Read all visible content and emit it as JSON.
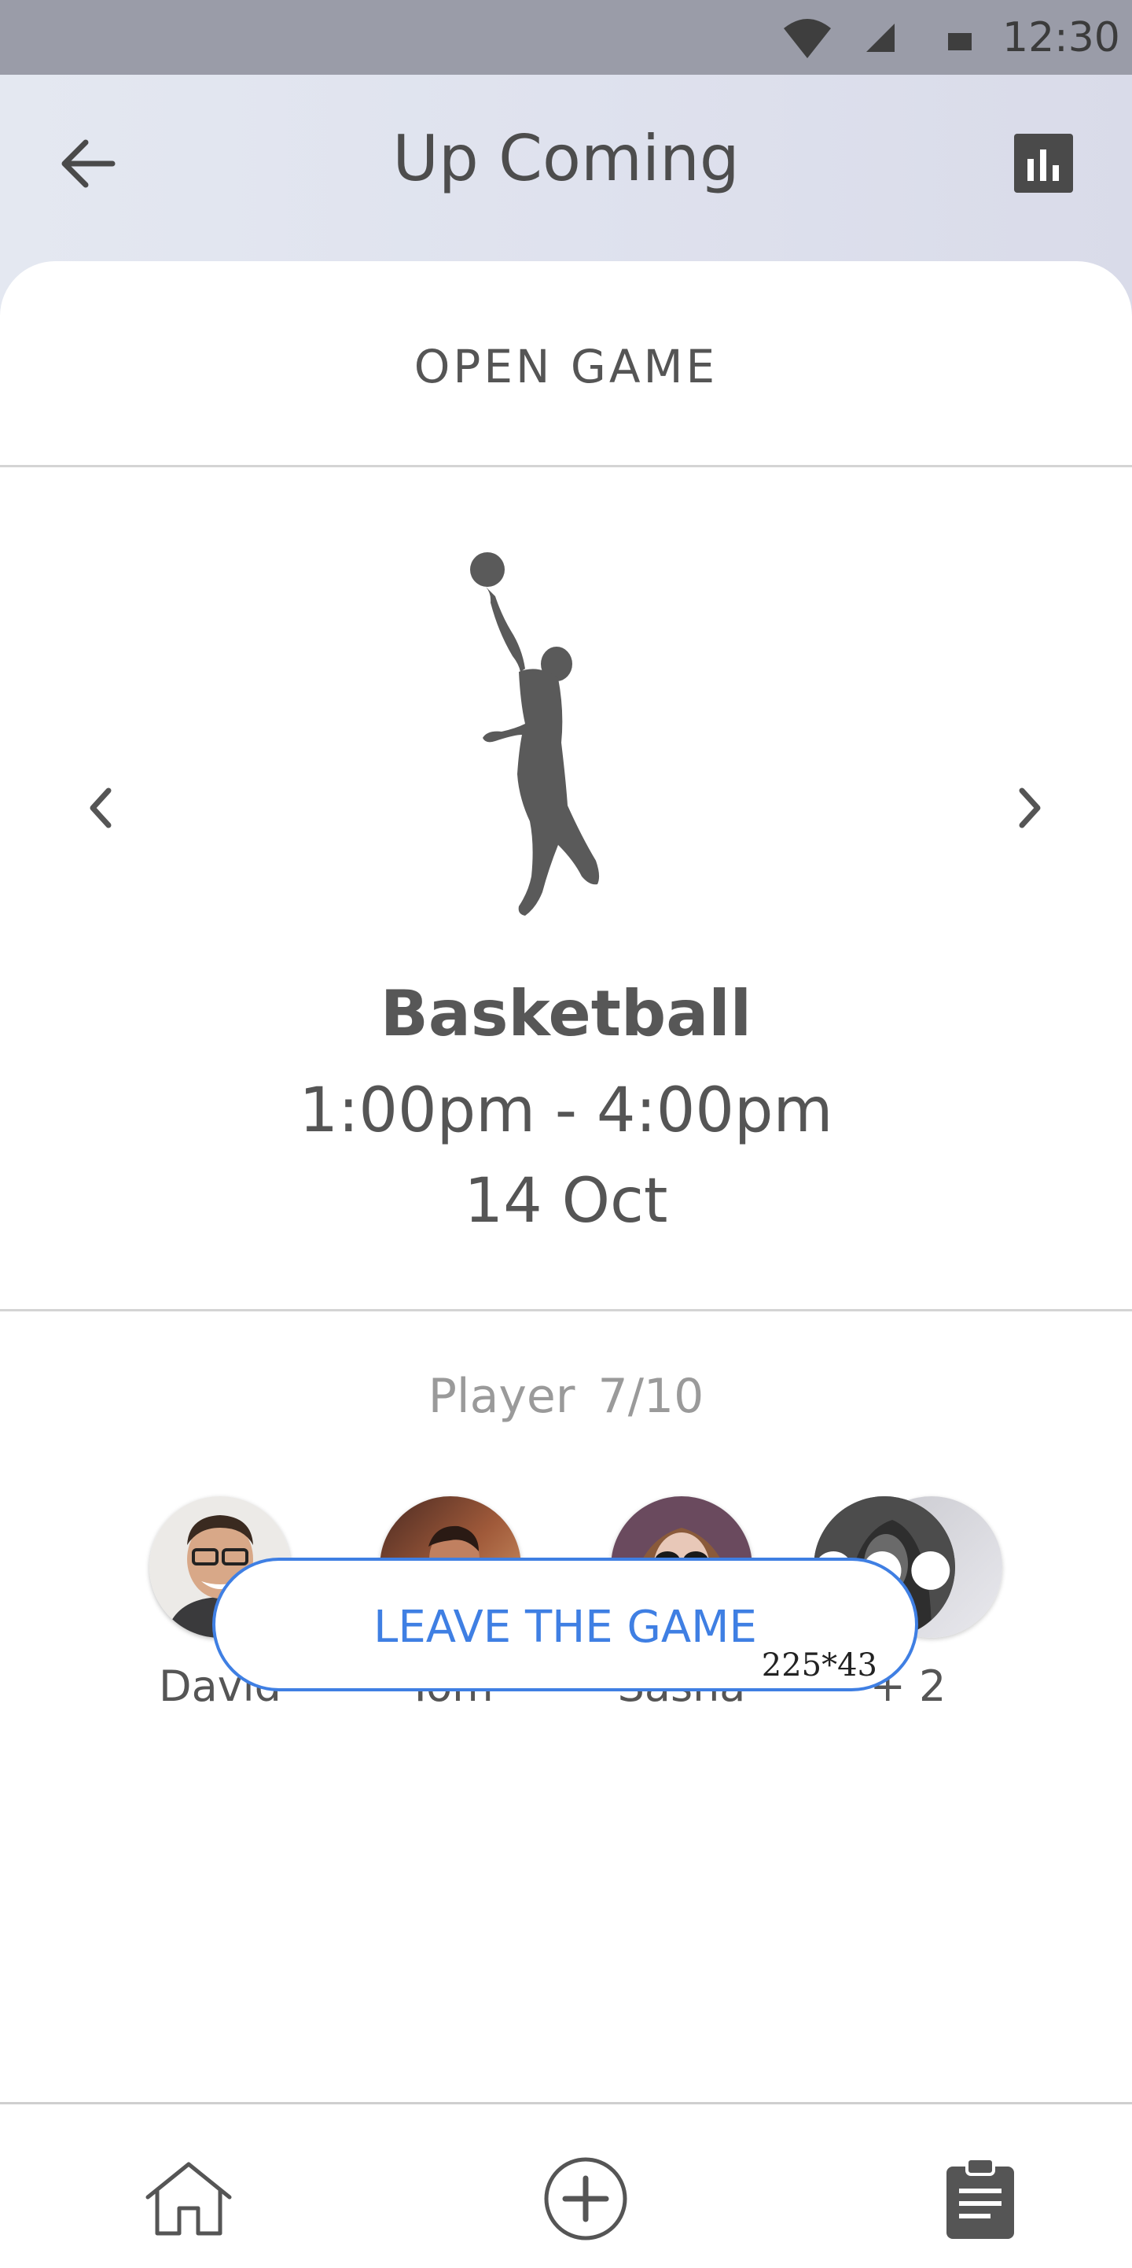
{
  "status_bar": {
    "time": "12:30",
    "wifi_icon": "wifi-icon",
    "signal_icon": "signal-icon",
    "battery_icon": "battery-icon"
  },
  "header": {
    "title": "Up Coming",
    "back_icon": "arrow-left-icon",
    "stats_icon": "bar-chart-icon"
  },
  "game": {
    "section_title": "OPEN GAME",
    "sport": "Basketball",
    "time": "1:00pm - 4:00pm",
    "date": "14 Oct",
    "image": "basketball-player-silhouette",
    "prev_icon": "chevron-left-icon",
    "next_icon": "chevron-right-icon"
  },
  "players": {
    "count_label": "Player 7/10",
    "list": [
      {
        "name": "David"
      },
      {
        "name": "Tom"
      },
      {
        "name": "Sasha"
      },
      {
        "name": "+ 2"
      }
    ]
  },
  "action": {
    "leave_label": "LEAVE THE GAME",
    "size_note": "225*43",
    "color": "#3f7fe3"
  },
  "tabbar": {
    "items": [
      "home-icon",
      "add-circle-icon",
      "clipboard-icon"
    ]
  }
}
